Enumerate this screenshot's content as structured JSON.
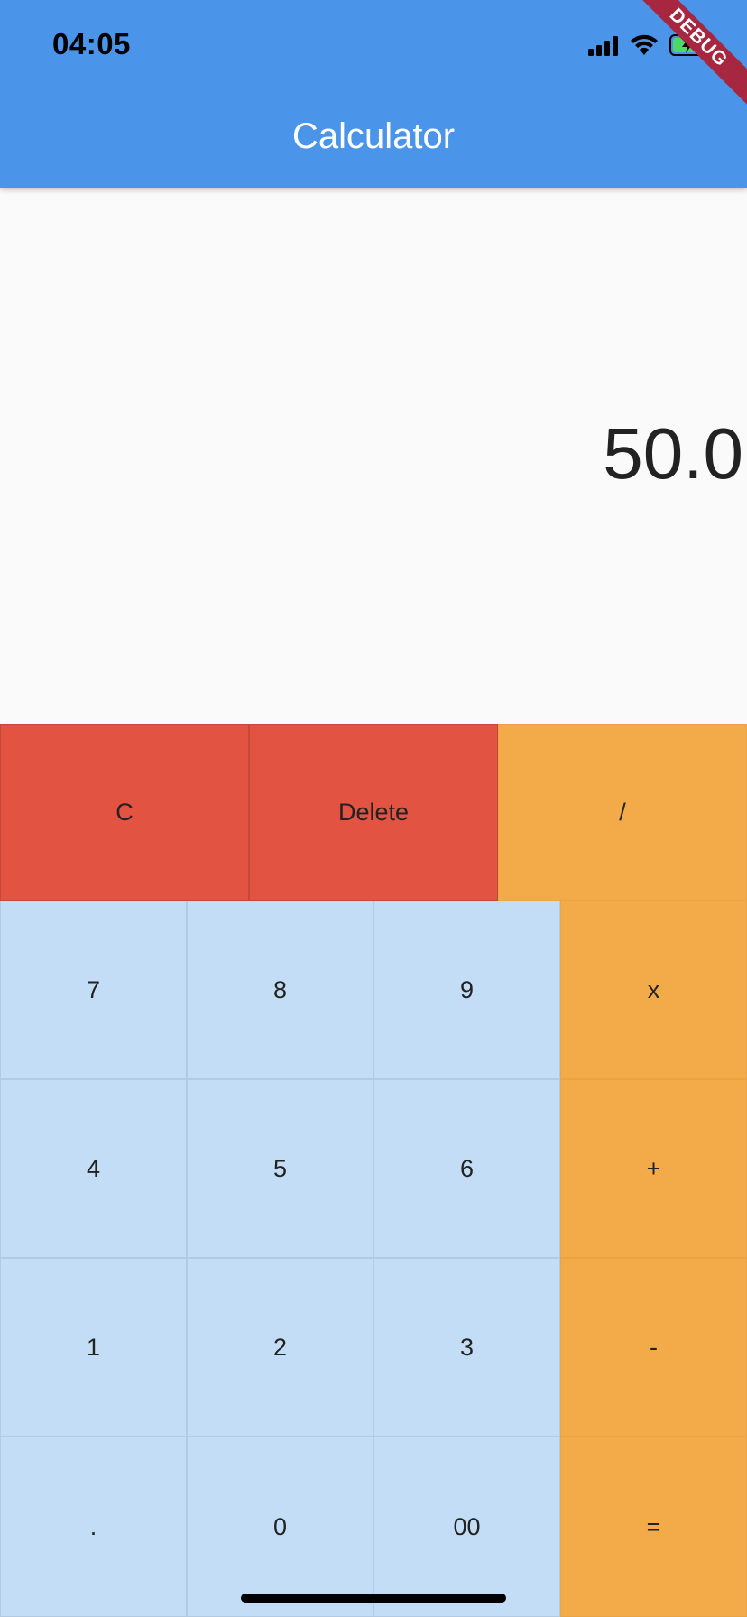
{
  "status_bar": {
    "time": "04:05",
    "icons": [
      "signal-icon",
      "wifi-icon",
      "battery-charging-icon"
    ]
  },
  "app_bar": {
    "title": "Calculator",
    "color": "#4a94ea"
  },
  "debug_banner": {
    "label": "DEBUG"
  },
  "display": {
    "value": "50.0"
  },
  "keypad": {
    "row1": [
      {
        "label": "C",
        "style": "red"
      },
      {
        "label": "Delete",
        "style": "red"
      },
      {
        "label": "/",
        "style": "orange"
      }
    ],
    "row2": [
      {
        "label": "7",
        "style": "blue"
      },
      {
        "label": "8",
        "style": "blue"
      },
      {
        "label": "9",
        "style": "blue"
      },
      {
        "label": "x",
        "style": "orange"
      }
    ],
    "row3": [
      {
        "label": "4",
        "style": "blue"
      },
      {
        "label": "5",
        "style": "blue"
      },
      {
        "label": "6",
        "style": "blue"
      },
      {
        "label": "+",
        "style": "orange"
      }
    ],
    "row4": [
      {
        "label": "1",
        "style": "blue"
      },
      {
        "label": "2",
        "style": "blue"
      },
      {
        "label": "3",
        "style": "blue"
      },
      {
        "label": "-",
        "style": "orange"
      }
    ],
    "row5": [
      {
        "label": ".",
        "style": "blue"
      },
      {
        "label": "0",
        "style": "blue"
      },
      {
        "label": "00",
        "style": "blue"
      },
      {
        "label": "=",
        "style": "orange"
      }
    ]
  },
  "colors": {
    "red": "#e25342",
    "orange": "#f2ab48",
    "blue": "#c3ddf6"
  }
}
